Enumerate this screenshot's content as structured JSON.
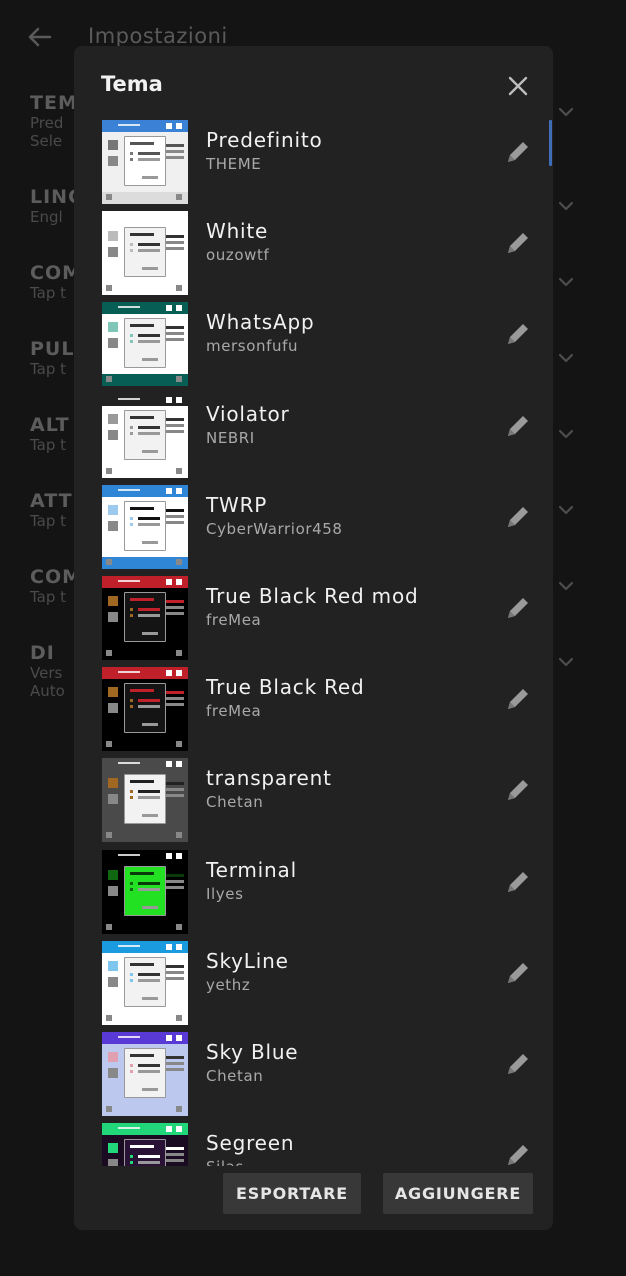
{
  "background": {
    "title": "Impostazioni",
    "items": [
      {
        "title": "TEM",
        "subs": [
          "Pred",
          "Sele"
        ]
      },
      {
        "title": "LING",
        "subs": [
          "Engl"
        ]
      },
      {
        "title": "COM",
        "subs": [
          "Tap t"
        ]
      },
      {
        "title": "PUL",
        "subs": [
          "Tap t"
        ]
      },
      {
        "title": "ALT",
        "subs": [
          "Tap t"
        ]
      },
      {
        "title": "ATT",
        "subs": [
          "Tap t"
        ]
      },
      {
        "title": "COM",
        "subs": [
          "Tap t"
        ]
      },
      {
        "title": "DI",
        "subs": [
          "Vers",
          "Auto"
        ]
      }
    ]
  },
  "dialog": {
    "title": "Tema",
    "themes": [
      {
        "name": "Predefinito",
        "author": "THEME",
        "colors": {
          "bg": "#f0f0f0",
          "bar": "#3b82d6",
          "panel": "#ffffff",
          "accent": "#555555",
          "square": "#777777",
          "bottom": "#dcdcdc"
        }
      },
      {
        "name": "White",
        "author": "ouzowtf",
        "colors": {
          "bg": "#ffffff",
          "bar": "#ffffff",
          "panel": "#f2f2f2",
          "accent": "#333333",
          "square": "#bbbbbb",
          "bottom": "#ffffff"
        }
      },
      {
        "name": "WhatsApp",
        "author": "mersonfufu",
        "colors": {
          "bg": "#ffffff",
          "bar": "#075e54",
          "panel": "#f2f2f2",
          "accent": "#333333",
          "square": "#7fc6b8",
          "bottom": "#075e54"
        }
      },
      {
        "name": "Violator",
        "author": "NEBRI",
        "colors": {
          "bg": "#ffffff",
          "bar": "#222222",
          "panel": "#f2f2f2",
          "accent": "#333333",
          "square": "#999999",
          "bottom": "#ffffff"
        }
      },
      {
        "name": "TWRP",
        "author": "CyberWarrior458",
        "colors": {
          "bg": "#ffffff",
          "bar": "#2f86d6",
          "panel": "#ffffff",
          "accent": "#111111",
          "square": "#9cc9ee",
          "bottom": "#2f86d6"
        }
      },
      {
        "name": "True Black Red mod",
        "author": "freMea",
        "colors": {
          "bg": "#000000",
          "bar": "#c0202a",
          "panel": "#141414",
          "accent": "#c0202a",
          "square": "#a06820",
          "bottom": "#000000"
        }
      },
      {
        "name": "True Black Red",
        "author": "freMea",
        "colors": {
          "bg": "#000000",
          "bar": "#c0202a",
          "panel": "#141414",
          "accent": "#c0202a",
          "square": "#a06820",
          "bottom": "#000000"
        }
      },
      {
        "name": "transparent",
        "author": "Chetan",
        "colors": {
          "bg": "#4a4a4a",
          "bar": "#4a4a4a",
          "panel": "#f2f2f2",
          "accent": "#222222",
          "square": "#a06820",
          "bottom": "#4a4a4a"
        }
      },
      {
        "name": "Terminal",
        "author": "Ilyes",
        "colors": {
          "bg": "#000000",
          "bar": "#000000",
          "panel": "#22e022",
          "accent": "#0a3a0a",
          "square": "#116611",
          "bottom": "#000000"
        }
      },
      {
        "name": "SkyLine",
        "author": "yethz",
        "colors": {
          "bg": "#ffffff",
          "bar": "#1a9be0",
          "panel": "#f2f2f2",
          "accent": "#333333",
          "square": "#7fc6ee",
          "bottom": "#ffffff"
        }
      },
      {
        "name": "Sky Blue",
        "author": "Chetan",
        "colors": {
          "bg": "#bcc8ee",
          "bar": "#5a3ad6",
          "panel": "#f2f2f2",
          "accent": "#333333",
          "square": "#e0a0b0",
          "bottom": "#bcc8ee"
        }
      },
      {
        "name": "Segreen",
        "author": "Silas",
        "colors": {
          "bg": "#1a0a22",
          "bar": "#22d67a",
          "panel": "#2a1236",
          "accent": "#ffffff",
          "square": "#22d67a",
          "bottom": "#1a0a22"
        }
      }
    ],
    "export_label": "ESPORTARE",
    "add_label": "AGGIUNGERE"
  }
}
